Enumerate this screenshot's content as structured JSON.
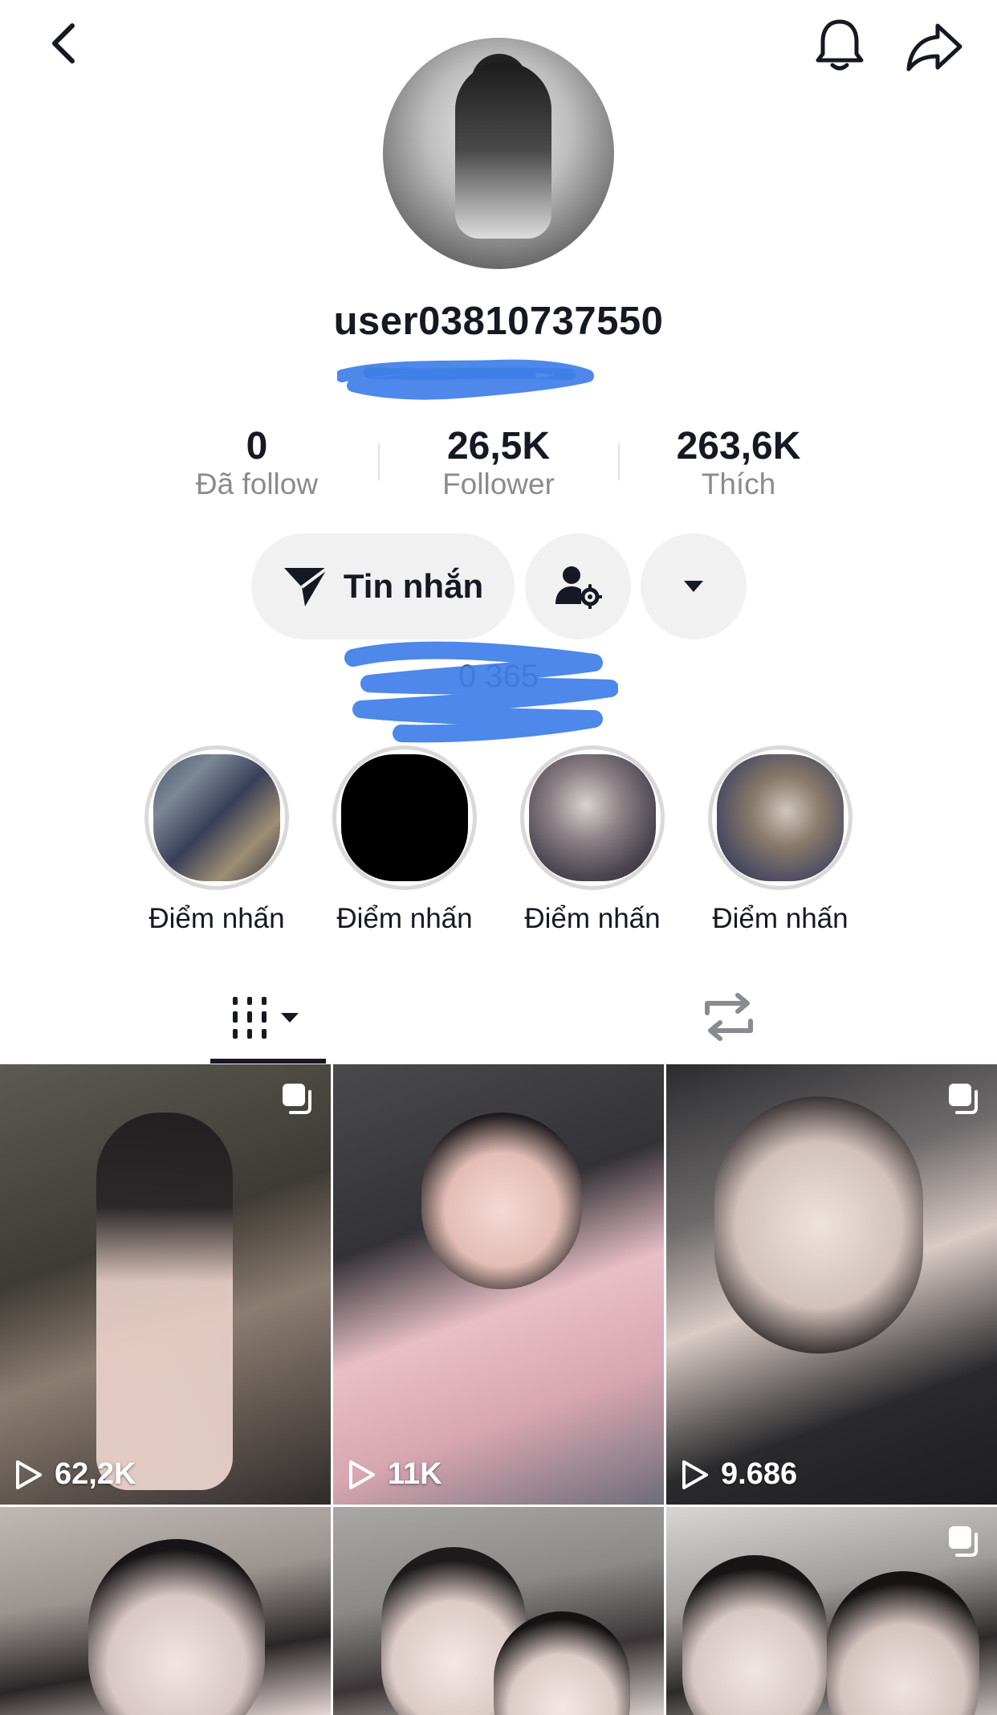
{
  "header": {
    "back_icon": "chevron-left-icon",
    "bell_icon": "bell-icon",
    "share_icon": "share-arrow-icon"
  },
  "profile": {
    "username": "user03810737550",
    "stats": [
      {
        "value": "0",
        "label": "Đã follow"
      },
      {
        "value": "26,5K",
        "label": "Follower"
      },
      {
        "value": "263,6K",
        "label": "Thích"
      }
    ]
  },
  "actions": {
    "message_label": "Tin nhắn",
    "message_icon": "send-icon",
    "friend_settings_icon": "person-gear-icon",
    "more_icon": "caret-down-icon"
  },
  "bio_partial": "0             365",
  "highlights": [
    {
      "label": "Điểm nhấn"
    },
    {
      "label": "Điểm nhấn"
    },
    {
      "label": "Điểm nhấn"
    },
    {
      "label": "Điểm nhấn"
    }
  ],
  "tabs": [
    {
      "name": "videos",
      "icon": "grid-bars-icon",
      "active": true
    },
    {
      "name": "reposts",
      "icon": "repost-icon",
      "active": false
    }
  ],
  "videos": [
    {
      "views": "62,2K",
      "multi": true
    },
    {
      "views": "11K",
      "multi": false
    },
    {
      "views": "9.686",
      "multi": true
    },
    {
      "views": "",
      "multi": false
    },
    {
      "views": "",
      "multi": false
    },
    {
      "views": "",
      "multi": true
    }
  ],
  "colors": {
    "text": "#161823",
    "muted": "#8a8b91",
    "button_bg": "#f1f1f2",
    "scribble": "#3e7ee8"
  }
}
